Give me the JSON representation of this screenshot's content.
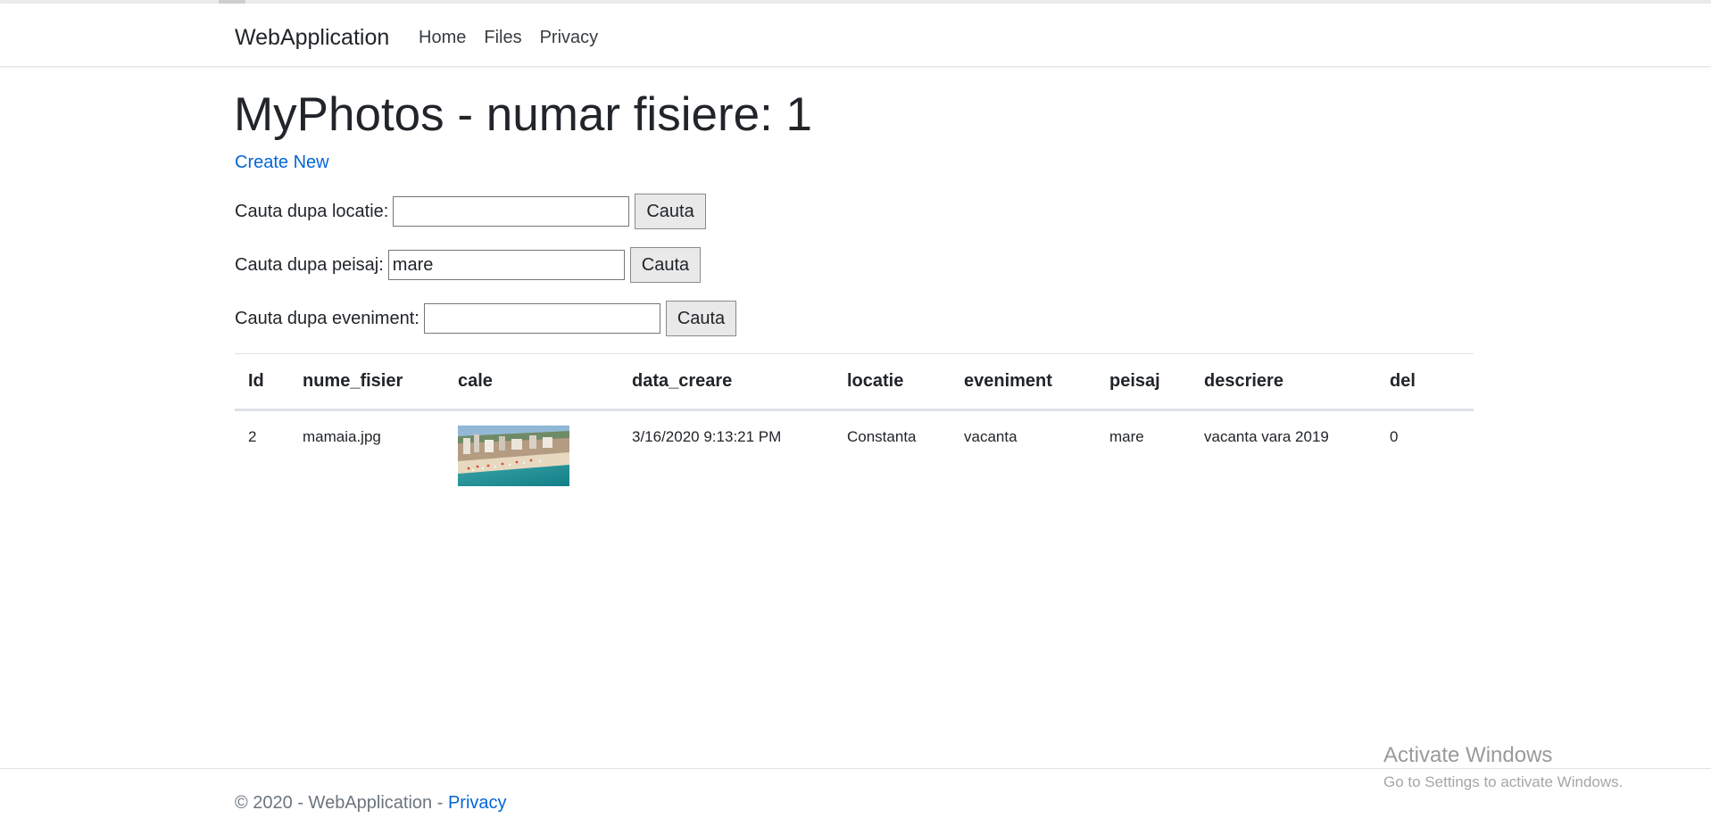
{
  "navbar": {
    "brand": "WebApplication",
    "links": [
      "Home",
      "Files",
      "Privacy"
    ]
  },
  "main": {
    "title": "MyPhotos - numar fisiere: 1",
    "create_new": "Create New",
    "searches": [
      {
        "label": "Cauta dupa locatie:",
        "value": "",
        "button": "Cauta"
      },
      {
        "label": "Cauta dupa peisaj:",
        "value": "mare",
        "button": "Cauta"
      },
      {
        "label": "Cauta dupa eveniment:",
        "value": "",
        "button": "Cauta"
      }
    ]
  },
  "table": {
    "headers": [
      "Id",
      "nume_fisier",
      "cale",
      "data_creare",
      "locatie",
      "eveniment",
      "peisaj",
      "descriere",
      "del"
    ],
    "rows": [
      {
        "id": "2",
        "nume_fisier": "mamaia.jpg",
        "cale": "beach-aerial-photo",
        "data_creare": "3/16/2020 9:13:21 PM",
        "locatie": "Constanta",
        "eveniment": "vacanta",
        "peisaj": "mare",
        "descriere": "vacanta vara 2019",
        "del": "0"
      }
    ]
  },
  "footer": {
    "text": "© 2020 - WebApplication - ",
    "link": "Privacy"
  },
  "watermark": {
    "title": "Activate Windows",
    "subtitle": "Go to Settings to activate Windows."
  },
  "colors": {
    "link": "#0366d6",
    "text": "#212529",
    "border": "#dee2e6"
  }
}
